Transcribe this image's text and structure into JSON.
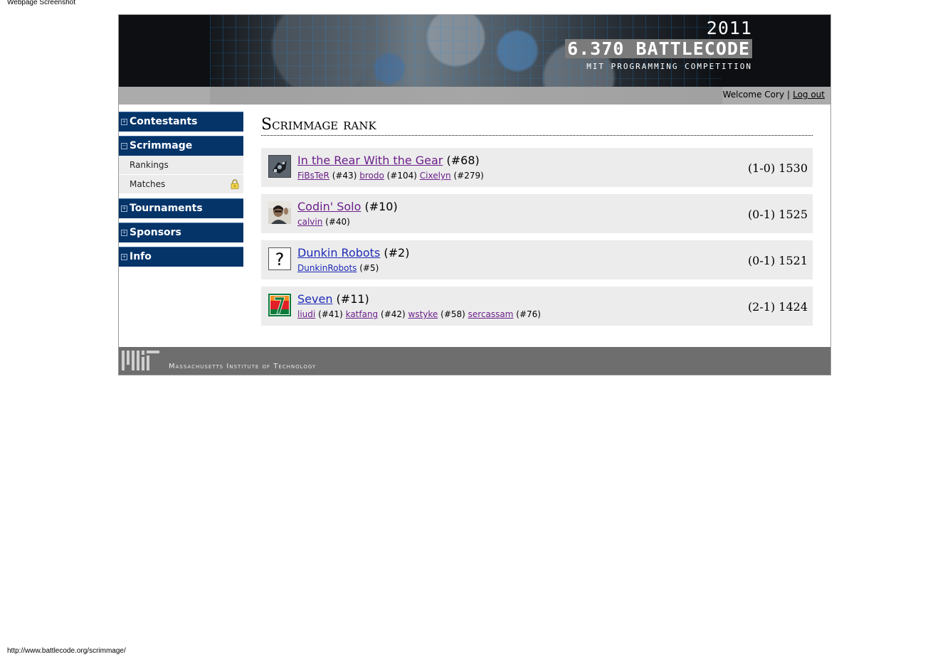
{
  "browser": {
    "caption": "Webpage Screenshot",
    "status_url": "http://www.battlecode.org/scrimmage/"
  },
  "header": {
    "year": "2011",
    "title": "6.370 BATTLECODE",
    "subtitle": "MIT PROGRAMMING COMPETITION",
    "welcome": "Welcome Cory",
    "separator": "|",
    "logout_label": "Log out"
  },
  "sidebar": {
    "sections": [
      {
        "label": "Contestants",
        "toggle": "+"
      },
      {
        "label": "Scrimmage",
        "toggle": "−",
        "items": [
          {
            "label": "Rankings"
          },
          {
            "label": "Matches",
            "icon": "lock-icon"
          }
        ]
      },
      {
        "label": "Tournaments",
        "toggle": "+"
      },
      {
        "label": "Sponsors",
        "toggle": "+"
      },
      {
        "label": "Info",
        "toggle": "+"
      }
    ]
  },
  "main": {
    "title": "Scrimmage rank",
    "teams": [
      {
        "name": "In the Rear With the Gear",
        "rank": "(#68)",
        "record": "(1-0) 1530",
        "avatar": "robot-avatar",
        "members": [
          {
            "name": "FiBsTeR",
            "rank": "(#43)"
          },
          {
            "name": "brodo",
            "rank": "(#104)"
          },
          {
            "name": "Cixelyn",
            "rank": "(#279)"
          }
        ]
      },
      {
        "name": "Codin' Solo",
        "rank": "(#10)",
        "record": "(0-1) 1525",
        "avatar": "photo-avatar",
        "members": [
          {
            "name": "calvin",
            "rank": "(#40)"
          }
        ]
      },
      {
        "name": "Dunkin Robots",
        "rank": "(#2)",
        "record": "(0-1) 1521",
        "avatar": "question-avatar",
        "members": [
          {
            "name": "DunkinRobots",
            "rank": "(#5)"
          }
        ]
      },
      {
        "name": "Seven",
        "rank": "(#11)",
        "record": "(2-1) 1424",
        "avatar": "seven-eleven-avatar",
        "members": [
          {
            "name": "liudi",
            "rank": "(#41)"
          },
          {
            "name": "katfang",
            "rank": "(#42)"
          },
          {
            "name": "wstyke",
            "rank": "(#58)"
          },
          {
            "name": "sercassam",
            "rank": "(#76)"
          }
        ]
      }
    ]
  },
  "footer": {
    "institution": "Massachusetts Institute of Technology"
  },
  "colors": {
    "nav_bg": "#053469",
    "row_bg": "#ececec",
    "visited_link": "#6b1f8a",
    "link": "#1f2bb8",
    "footer_bg": "#6e6e6e"
  }
}
